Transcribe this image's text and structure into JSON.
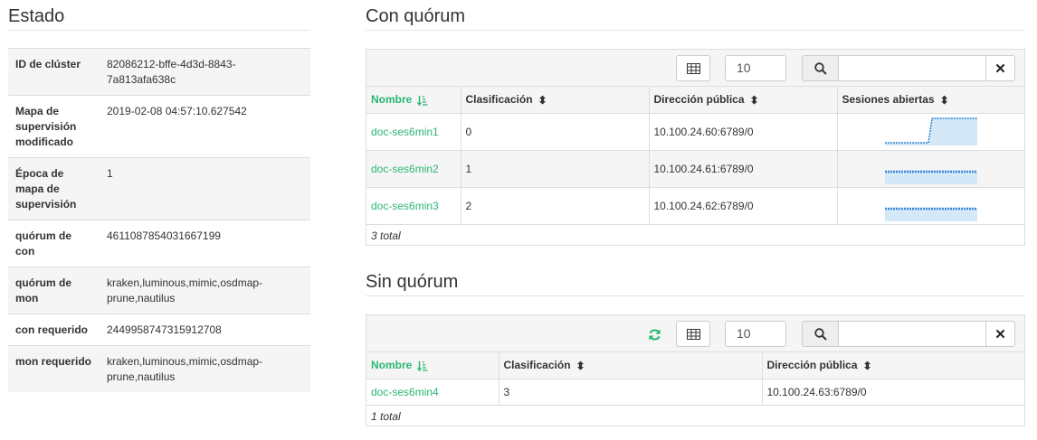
{
  "status": {
    "title": "Estado",
    "rows": [
      {
        "key": "ID de clúster",
        "value": "82086212-bffe-4d3d-8843-7a813afa638c"
      },
      {
        "key": "Mapa de supervisión modificado",
        "value": "2019-02-08 04:57:10.627542"
      },
      {
        "key": "Época de mapa de supervisión",
        "value": "1"
      },
      {
        "key": "quórum de con",
        "value": "4611087854031667199"
      },
      {
        "key": "quórum de mon",
        "value": "kraken,luminous,mimic,osdmap-prune,nautilus"
      },
      {
        "key": "con requerido",
        "value": "2449958747315912708"
      },
      {
        "key": "mon requerido",
        "value": "kraken,luminous,mimic,osdmap-prune,nautilus"
      }
    ]
  },
  "in_quorum": {
    "title": "Con quórum",
    "page_size": "10",
    "columns": [
      "Nombre",
      "Clasificación",
      "Dirección pública",
      "Sesiones abiertas"
    ],
    "rows": [
      {
        "name": "doc-ses6min1",
        "rank": "0",
        "address": "10.100.24.60:6789/0"
      },
      {
        "name": "doc-ses6min2",
        "rank": "1",
        "address": "10.100.24.61:6789/0"
      },
      {
        "name": "doc-ses6min3",
        "rank": "2",
        "address": "10.100.24.62:6789/0"
      }
    ],
    "footer": "3 total"
  },
  "not_in_quorum": {
    "title": "Sin quórum",
    "page_size": "10",
    "columns": [
      "Nombre",
      "Clasificación",
      "Dirección pública"
    ],
    "rows": [
      {
        "name": "doc-ses6min4",
        "rank": "3",
        "address": "10.100.24.63:6789/0"
      }
    ],
    "footer": "1 total"
  },
  "icons": {
    "columns_toggle": "table-icon",
    "search": "search-icon",
    "clear": "close-icon",
    "refresh": "refresh-icon",
    "sort_asc": "sort-alpha-asc-icon",
    "sort": "sort-icon"
  },
  "colors": {
    "accent": "#2bb673",
    "sparkline": "#2e86d6",
    "sparkline_fill": "#d5e8f7"
  }
}
